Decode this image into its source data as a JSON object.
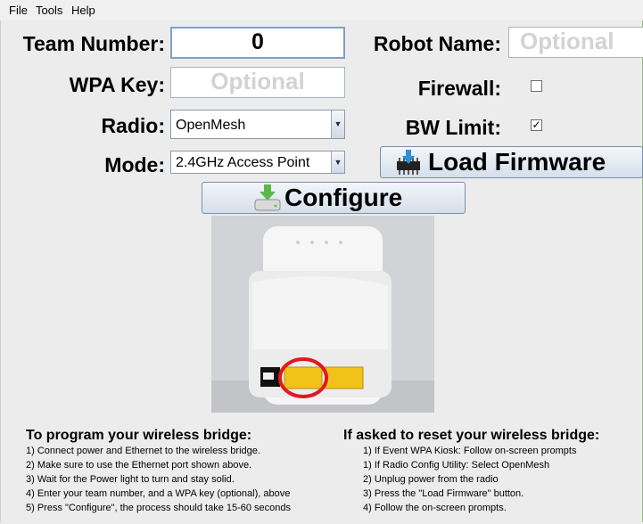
{
  "menu": {
    "file": "File",
    "tools": "Tools",
    "help": "Help"
  },
  "form": {
    "team_number_label": "Team Number:",
    "team_number_value": "0",
    "robot_name_label": "Robot Name:",
    "robot_name_placeholder": "Optional",
    "wpa_key_label": "WPA Key:",
    "wpa_key_placeholder": "Optional",
    "firewall_label": "Firewall:",
    "firewall_checked": false,
    "radio_label": "Radio:",
    "radio_value": "OpenMesh",
    "bw_limit_label": "BW Limit:",
    "bw_limit_checked": true,
    "mode_label": "Mode:",
    "mode_value": "2.4GHz Access Point"
  },
  "buttons": {
    "load_firmware": "Load Firmware",
    "configure": "Configure"
  },
  "icons": {
    "load_firmware": "chip-download-icon",
    "configure": "drive-download-icon",
    "dropdown": "triangle-down-icon",
    "check": "✓"
  },
  "colors": {
    "highlight_circle": "#e21a1a",
    "ethernet_port": "#f2c21b"
  },
  "instructions": {
    "program": {
      "title": "To program your wireless bridge:",
      "steps": [
        "1) Connect power and Ethernet to the wireless bridge.",
        "2) Make sure to use the Ethernet port shown above.",
        "3) Wait for the Power light to turn and stay solid.",
        "4) Enter your team number, and a WPA key (optional), above",
        "5) Press \"Configure\", the process should take 15-60 seconds"
      ]
    },
    "reset": {
      "title": "If asked to reset your wireless bridge:",
      "steps": [
        "1) If Event WPA Kiosk: Follow on-screen prompts",
        "1) If Radio Config Utility: Select OpenMesh",
        "2) Unplug power from the radio",
        "3) Press the \"Load Firmware\" button.",
        "4) Follow the on-screen prompts."
      ]
    }
  }
}
